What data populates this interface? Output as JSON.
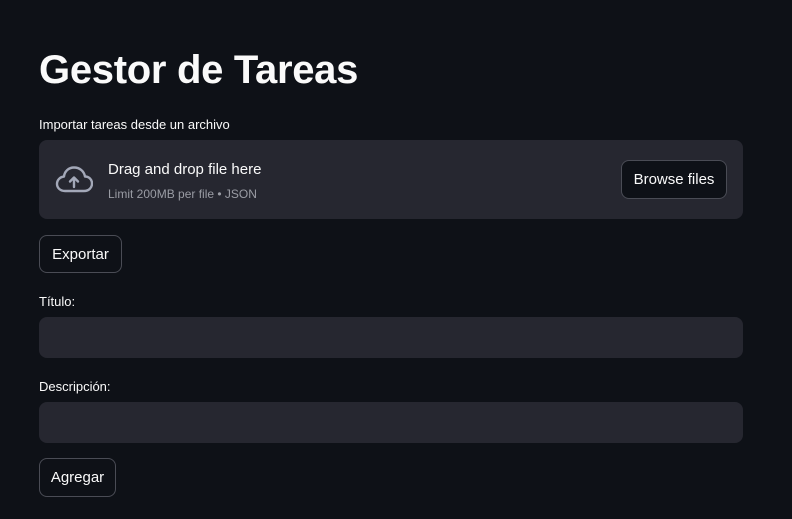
{
  "page": {
    "title": "Gestor de Tareas"
  },
  "uploader": {
    "label": "Importar tareas desde un archivo",
    "drop_text": "Drag and drop file here",
    "limit_text": "Limit 200MB per file • JSON",
    "browse_label": "Browse files",
    "icon": "cloud-upload-icon"
  },
  "actions": {
    "export_label": "Exportar",
    "add_label": "Agregar"
  },
  "form": {
    "title_label": "Título:",
    "title_value": "",
    "description_label": "Descripción:",
    "description_value": ""
  },
  "colors": {
    "background": "#0e1117",
    "surface": "#262730",
    "text": "#fafafa",
    "muted_text": "#9a9ca4",
    "button_border": "#4a4c55"
  }
}
